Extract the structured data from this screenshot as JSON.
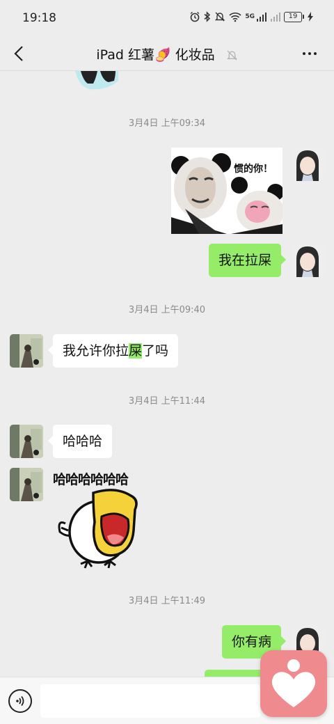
{
  "status": {
    "time": "19:18",
    "network": "5G",
    "battery": "19"
  },
  "header": {
    "title": "iPad 红薯🍠 化妆品"
  },
  "messages": {
    "ts1": "3月4日 上午09:34",
    "ts2": "3月4日 上午09:40",
    "ts3": "3月4日 上午11:44",
    "ts4": "3月4日 上午11:49",
    "out_sticker_caption": "惯的你！",
    "out1": "我在拉屎",
    "in1_a": "我允许你拉",
    "in1_hl": "屎",
    "in1_b": "了吗",
    "in2": "哈哈哈",
    "in3_sticker_text": "哈哈哈哈哈哈",
    "out2": "你有病"
  },
  "input": {
    "value": "",
    "placeholder": ""
  },
  "colors": {
    "background": "#ededed",
    "bubble_out": "#95ec69",
    "bubble_in": "#ffffff",
    "timestamp": "#8a8a8a",
    "float_app": "#ef8a8f"
  },
  "icons": [
    "back-arrow-icon",
    "mute-bell-icon",
    "more-dots-icon",
    "voice-icon",
    "heart-app-icon",
    "alarm-icon",
    "bluetooth-icon",
    "silent-icon",
    "wifi-icon",
    "signal-icon",
    "battery-icon",
    "charging-icon"
  ]
}
